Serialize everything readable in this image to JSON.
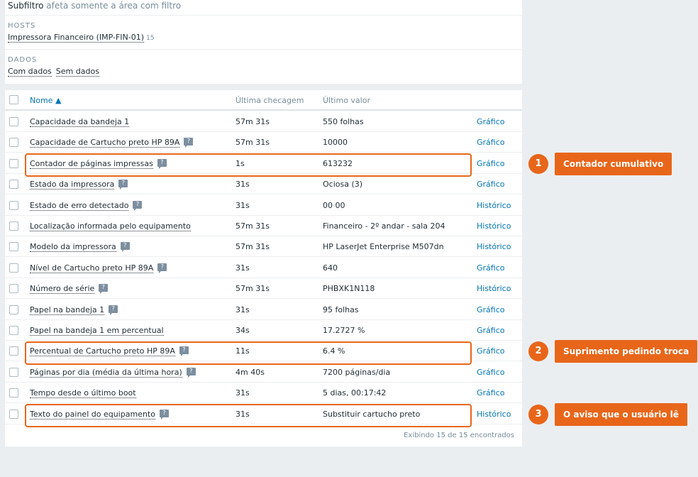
{
  "filter": {
    "subfilter_label": "Subfiltro",
    "subfilter_note": "afeta somente a área com filtro",
    "hosts_label": "HOSTS",
    "host_name": "Impressora Financeiro (IMP-FIN-01)",
    "host_count": "15",
    "data_label": "DADOS",
    "data_with": "Com dados",
    "data_without": "Sem dados"
  },
  "table": {
    "headers": {
      "name": "Nome ▲",
      "last_check": "Última checagem",
      "last_value": "Último valor"
    },
    "rows": [
      {
        "name": "Capacidade da bandeja 1",
        "hint": false,
        "check": "57m 31s",
        "value": "550 folhas",
        "action": "Gráfico"
      },
      {
        "name": "Capacidade de Cartucho preto HP 89A",
        "hint": true,
        "check": "57m 31s",
        "value": "10000",
        "action": "Gráfico"
      },
      {
        "name": "Contador de páginas impressas",
        "hint": true,
        "check": "1s",
        "value": "613232",
        "action": "Gráfico"
      },
      {
        "name": "Estado da impressora",
        "hint": true,
        "check": "31s",
        "value": "Ociosa (3)",
        "action": "Gráfico"
      },
      {
        "name": "Estado de erro detectado",
        "hint": true,
        "check": "31s",
        "value": "00 00",
        "action": "Histórico"
      },
      {
        "name": "Localização informada pelo equipamento",
        "hint": false,
        "check": "57m 31s",
        "value": "Financeiro - 2º andar - sala 204",
        "action": "Histórico"
      },
      {
        "name": "Modelo da impressora",
        "hint": true,
        "check": "57m 31s",
        "value": "HP LaserJet Enterprise M507dn",
        "action": "Histórico"
      },
      {
        "name": "Nível de Cartucho preto HP 89A",
        "hint": true,
        "check": "31s",
        "value": "640",
        "action": "Gráfico"
      },
      {
        "name": "Número de série",
        "hint": true,
        "check": "57m 31s",
        "value": "PHBXK1N118",
        "action": "Histórico"
      },
      {
        "name": "Papel na bandeja 1",
        "hint": true,
        "check": "31s",
        "value": "95 folhas",
        "action": "Gráfico"
      },
      {
        "name": "Papel na bandeja 1 em percentual",
        "hint": false,
        "check": "34s",
        "value": "17.2727 %",
        "action": "Gráfico"
      },
      {
        "name": "Percentual de Cartucho preto HP 89A",
        "hint": true,
        "check": "11s",
        "value": "6.4 %",
        "action": "Gráfico"
      },
      {
        "name": "Páginas por dia (média da última hora)",
        "hint": true,
        "check": "4m 40s",
        "value": "7200 páginas/dia",
        "action": "Gráfico"
      },
      {
        "name": "Tempo desde o último boot",
        "hint": false,
        "check": "31s",
        "value": "5 dias, 00:17:42",
        "action": "Gráfico"
      },
      {
        "name": "Texto do painel do equipamento",
        "hint": true,
        "check": "31s",
        "value": "Substituir cartucho preto",
        "action": "Histórico"
      }
    ],
    "footer": "Exibindo 15 de 15 encontrados"
  },
  "annotations": [
    {
      "number": "1",
      "text": "Contador cumulativo"
    },
    {
      "number": "2",
      "text": "Suprimento pedindo troca"
    },
    {
      "number": "3",
      "text": "O aviso que o usuário lê"
    }
  ],
  "colors": {
    "accent": "#e8661a",
    "link": "#0275b8"
  }
}
